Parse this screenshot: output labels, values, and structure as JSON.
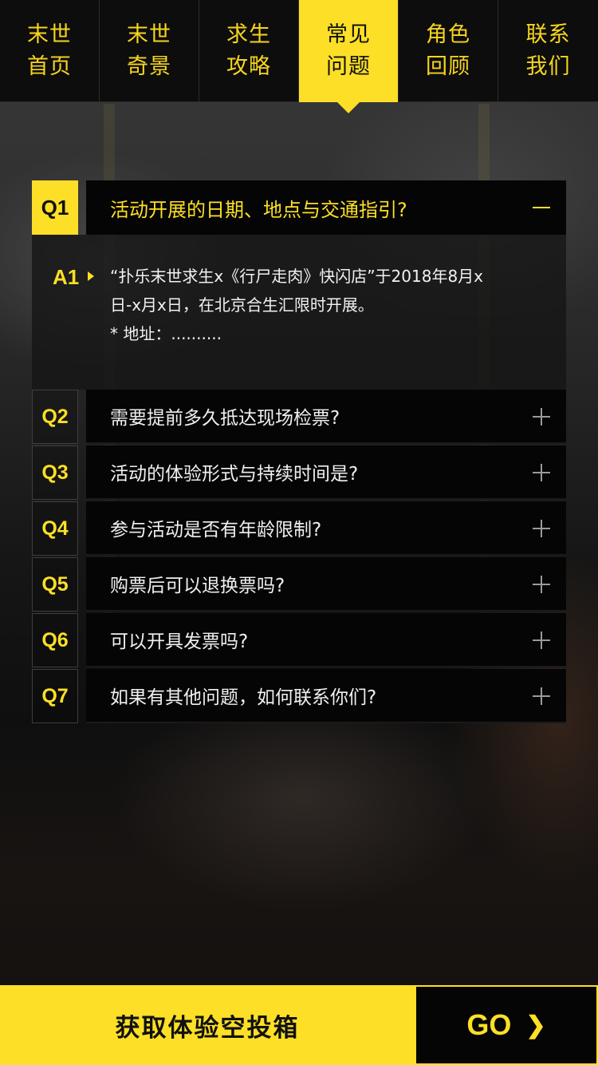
{
  "nav": {
    "items": [
      {
        "line1": "末世",
        "line2": "首页"
      },
      {
        "line1": "末世",
        "line2": "奇景"
      },
      {
        "line1": "求生",
        "line2": "攻略"
      },
      {
        "line1": "常见",
        "line2": "问题"
      },
      {
        "line1": "角色",
        "line2": "回顾"
      },
      {
        "line1": "联系",
        "line2": "我们"
      }
    ],
    "active": "常见问题"
  },
  "faq": {
    "open": {
      "num": "Q1",
      "question": "活动开展的日期、地点与交通指引?",
      "toggle": "minus",
      "answer_label": "A1",
      "answer_lines": [
        "“扑乐末世求生x《行尸走肉》快闪店”于2018年8月x",
        "日-x月x日，在北京合生汇限时开展。",
        "* 地址：.........."
      ]
    },
    "items": [
      {
        "num": "Q2",
        "question": "需要提前多久抵达现场检票?"
      },
      {
        "num": "Q3",
        "question": "活动的体验形式与持续时间是?"
      },
      {
        "num": "Q4",
        "question": "参与活动是否有年龄限制?"
      },
      {
        "num": "Q5",
        "question": "购票后可以退换票吗?"
      },
      {
        "num": "Q6",
        "question": "可以开具发票吗?"
      },
      {
        "num": "Q7",
        "question": "如果有其他问题，如何联系你们?"
      }
    ]
  },
  "bottom": {
    "cta_label": "获取体验空投箱",
    "go_label": "GO",
    "go_arrow": "❯"
  },
  "colors": {
    "accent": "#fcdf26",
    "nav_bg": "#0d0d0d",
    "bar_bg": "#050505"
  },
  "icons": {
    "open_toggle": "minus-icon",
    "closed_toggle": "plus-icon",
    "answer_marker": "triangle-right-icon",
    "go_arrow": "chevron-right-icon"
  }
}
